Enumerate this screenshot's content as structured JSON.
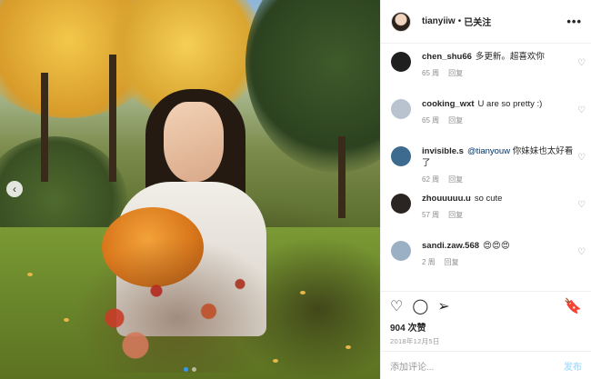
{
  "post": {
    "username": "tianyiiw",
    "separator": "•",
    "follow_status": "已关注",
    "more_icon": "•••",
    "carousel": {
      "prev_icon": "‹",
      "slide_count": 2,
      "active_slide": 1
    }
  },
  "comments": [
    {
      "user": "chen_shu66",
      "text": "多更新。超喜欢你",
      "mention": "",
      "time": "65 周",
      "reply": "回复",
      "avatar_color": "#1f1f1f"
    },
    {
      "user": "cooking_wxt",
      "text": "U are so pretty :)",
      "mention": "",
      "time": "65 周",
      "reply": "回复",
      "avatar_color": "#b9c3cf"
    },
    {
      "user": "invisible.s",
      "mention": "@tianyouw",
      "text": "你妹妹也太好看了",
      "time": "62 周",
      "reply": "回复",
      "avatar_color": "#3c6b8f"
    },
    {
      "user": "zhouuuuu.u",
      "text": "so cute",
      "mention": "",
      "time": "57 周",
      "reply": "回复",
      "avatar_color": "#2a2422"
    },
    {
      "user": "sandi.zaw.568",
      "text": "😍😍😍",
      "mention": "",
      "time": "2 周",
      "reply": "回复",
      "avatar_color": "#9bb0c4"
    }
  ],
  "actions": {
    "like_icon": "♡",
    "comment_icon": "◯",
    "share_icon": "➢",
    "bookmark_icon": "🔖"
  },
  "likes": "904 次赞",
  "date": "2018年12月5日",
  "add_comment": {
    "placeholder": "添加评论...",
    "post_label": "发布"
  },
  "comment_like_icon": "♡"
}
